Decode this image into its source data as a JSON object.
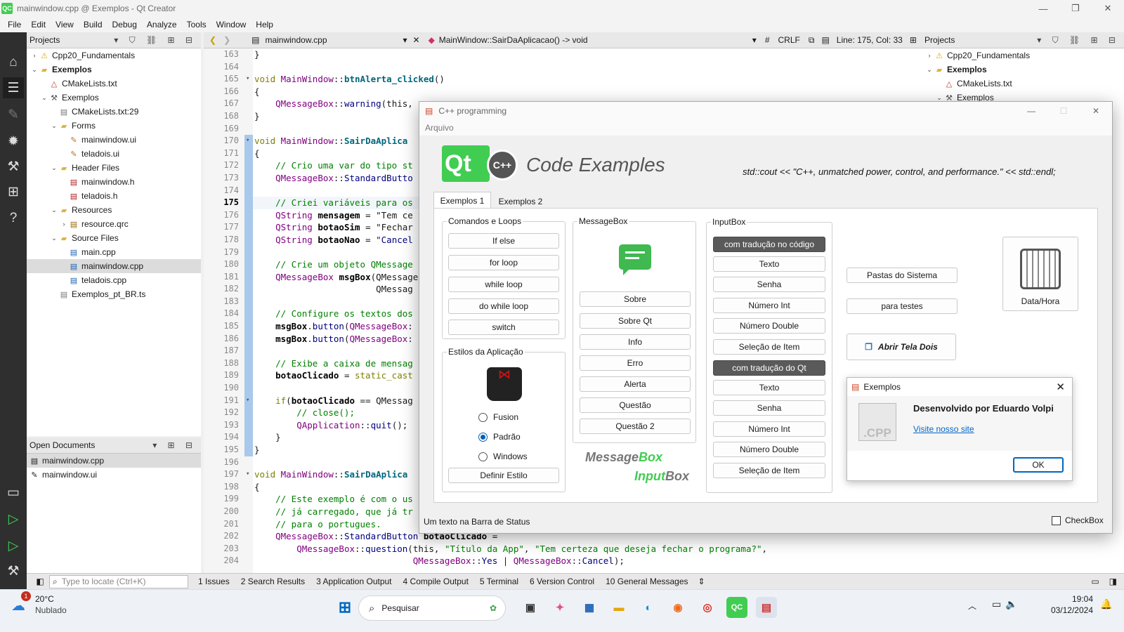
{
  "window": {
    "title": "mainwindow.cpp @ Exemplos - Qt Creator",
    "logo": "QC"
  },
  "menu": [
    "File",
    "Edit",
    "View",
    "Build",
    "Debug",
    "Analyze",
    "Tools",
    "Window",
    "Help"
  ],
  "left_panel": {
    "title": "Projects",
    "tree": [
      {
        "label": "Cpp20_Fundamentals",
        "indent": 0,
        "arrow": "›",
        "icon": "warning-icon",
        "bold": false
      },
      {
        "label": "Exemplos",
        "indent": 0,
        "arrow": "⌄",
        "icon": "folder-icon",
        "bold": true
      },
      {
        "label": "CMakeLists.txt",
        "indent": 1,
        "arrow": "",
        "icon": "cmake-file-icon",
        "bold": false
      },
      {
        "label": "Exemplos",
        "indent": 1,
        "arrow": "⌄",
        "icon": "hammer-icon",
        "bold": false
      },
      {
        "label": "CMakeLists.txt:29",
        "indent": 2,
        "arrow": "",
        "icon": "file-icon",
        "bold": false
      },
      {
        "label": "Forms",
        "indent": 2,
        "arrow": "⌄",
        "icon": "folder-icon",
        "bold": false
      },
      {
        "label": "mainwindow.ui",
        "indent": 3,
        "arrow": "",
        "icon": "ui-file-icon",
        "bold": false
      },
      {
        "label": "teladois.ui",
        "indent": 3,
        "arrow": "",
        "icon": "ui-file-icon",
        "bold": false
      },
      {
        "label": "Header Files",
        "indent": 2,
        "arrow": "⌄",
        "icon": "folder-icon",
        "bold": false
      },
      {
        "label": "mainwindow.h",
        "indent": 3,
        "arrow": "",
        "icon": "header-file-icon",
        "bold": false
      },
      {
        "label": "teladois.h",
        "indent": 3,
        "arrow": "",
        "icon": "header-file-icon",
        "bold": false
      },
      {
        "label": "Resources",
        "indent": 2,
        "arrow": "⌄",
        "icon": "folder-lock-icon",
        "bold": false
      },
      {
        "label": "resource.qrc",
        "indent": 3,
        "arrow": "›",
        "icon": "resource-file-icon",
        "bold": false
      },
      {
        "label": "Source Files",
        "indent": 2,
        "arrow": "⌄",
        "icon": "folder-icon",
        "bold": false
      },
      {
        "label": "main.cpp",
        "indent": 3,
        "arrow": "",
        "icon": "cpp-file-icon",
        "bold": false
      },
      {
        "label": "mainwindow.cpp",
        "indent": 3,
        "arrow": "",
        "icon": "cpp-file-icon",
        "bold": false,
        "selected": true
      },
      {
        "label": "teladois.cpp",
        "indent": 3,
        "arrow": "",
        "icon": "cpp-file-icon",
        "bold": false
      },
      {
        "label": "Exemplos_pt_BR.ts",
        "indent": 2,
        "arrow": "",
        "icon": "file-icon",
        "bold": false
      }
    ],
    "open_docs_title": "Open Documents",
    "open_docs": [
      "mainwindow.cpp",
      "mainwindow.ui"
    ]
  },
  "right_panel": {
    "title": "Projects",
    "tree": [
      {
        "label": "Cpp20_Fundamentals",
        "arrow": "›",
        "icon": "warning-icon",
        "bold": false,
        "indent": 0
      },
      {
        "label": "Exemplos",
        "arrow": "⌄",
        "icon": "folder-icon",
        "bold": true,
        "indent": 0
      },
      {
        "label": "CMakeLists.txt",
        "arrow": "",
        "icon": "cmake-file-icon",
        "bold": false,
        "indent": 1
      },
      {
        "label": "Exemplos",
        "arrow": "⌄",
        "icon": "hammer-icon",
        "bold": false,
        "indent": 1
      }
    ]
  },
  "editor_toolbar": {
    "file": "mainwindow.cpp",
    "symbol": "MainWindow::SairDaAplicacao() -> void",
    "hash": "#",
    "line_ending": "CRLF",
    "position": "Line: 175, Col: 33"
  },
  "code_lines": [
    {
      "n": "163",
      "c": "}"
    },
    {
      "n": "164",
      "c": ""
    },
    {
      "n": "165",
      "c": "void MainWindow::btnAlerta_clicked()"
    },
    {
      "n": "166",
      "c": "{"
    },
    {
      "n": "167",
      "c": "    QMessageBox::warning(this,"
    },
    {
      "n": "168",
      "c": "}"
    },
    {
      "n": "169",
      "c": ""
    },
    {
      "n": "170",
      "c": "void MainWindow::SairDaAplica"
    },
    {
      "n": "171",
      "c": "{"
    },
    {
      "n": "172",
      "c": "    // Crio uma var do tipo st"
    },
    {
      "n": "173",
      "c": "    QMessageBox::StandardButto"
    },
    {
      "n": "174",
      "c": ""
    },
    {
      "n": "175",
      "c": "    // Criei variáveis para os"
    },
    {
      "n": "176",
      "c": "    QString mensagem = \"Tem ce"
    },
    {
      "n": "177",
      "c": "    QString botaoSim = \"Fechar"
    },
    {
      "n": "178",
      "c": "    QString botaoNao = \"Cancel"
    },
    {
      "n": "179",
      "c": ""
    },
    {
      "n": "180",
      "c": "    // Crie um objeto QMessage"
    },
    {
      "n": "181",
      "c": "    QMessageBox msgBox(QMessage"
    },
    {
      "n": "182",
      "c": "                       QMessag"
    },
    {
      "n": "183",
      "c": ""
    },
    {
      "n": "184",
      "c": "    // Configure os textos dos"
    },
    {
      "n": "185",
      "c": "    msgBox.button(QMessageBox:"
    },
    {
      "n": "186",
      "c": "    msgBox.button(QMessageBox:"
    },
    {
      "n": "187",
      "c": ""
    },
    {
      "n": "188",
      "c": "    // Exibe a caixa de mensag"
    },
    {
      "n": "189",
      "c": "    botaoClicado = static_cast"
    },
    {
      "n": "190",
      "c": ""
    },
    {
      "n": "191",
      "c": "    if(botaoClicado == QMessag"
    },
    {
      "n": "192",
      "c": "        // close();"
    },
    {
      "n": "193",
      "c": "        QApplication::quit();"
    },
    {
      "n": "194",
      "c": "    }"
    },
    {
      "n": "195",
      "c": "}"
    },
    {
      "n": "196",
      "c": ""
    },
    {
      "n": "197",
      "c": "void MainWindow::SairDaAplica"
    },
    {
      "n": "198",
      "c": "{"
    },
    {
      "n": "199",
      "c": "    // Este exemplo é com o us"
    },
    {
      "n": "200",
      "c": "    // já carregado, que já tr"
    },
    {
      "n": "201",
      "c": "    // para o portugues."
    },
    {
      "n": "202",
      "c": "    QMessageBox::StandardButton botaoClicado ="
    },
    {
      "n": "203",
      "c": "        QMessageBox::question(this, \"Título da App\", \"Tem certeza que deseja fechar o programa?\","
    },
    {
      "n": "204",
      "c": "                              QMessageBox::Yes | QMessageBox::Cancel);"
    }
  ],
  "app": {
    "title": "C++ programming",
    "menu": "Arquivo",
    "logo_text": "Qt",
    "logo_sub": "C++",
    "heading": "Code Examples",
    "slogan": "std::cout << \"C++, unmatched power, control, and performance.\" << std::endl;",
    "tabs": [
      "Exemplos 1",
      "Exemplos 2"
    ],
    "group_loops": {
      "caption": "Comandos e Loops",
      "buttons": [
        "If else",
        "for loop",
        "while loop",
        "do while loop",
        "switch"
      ]
    },
    "group_styles": {
      "caption": "Estilos da Aplicação",
      "options": [
        "Fusion",
        "Padrão",
        "Windows"
      ],
      "selected": "Padrão",
      "button": "Definir Estilo"
    },
    "group_msgbox": {
      "caption": "MessageBox",
      "buttons": [
        "Sobre",
        "Sobre Qt",
        "Info",
        "Erro",
        "Alerta",
        "Questão",
        "Questão 2"
      ],
      "brand1a": "Message",
      "brand1b": "Box",
      "brand2a": "Input",
      "brand2b": "Box"
    },
    "group_input": {
      "caption": "InputBox",
      "header1": "com tradução no código",
      "buttons1": [
        "Texto",
        "Senha",
        "Número Int",
        "Número Double",
        "Seleção de Item"
      ],
      "header2": "com tradução do Qt",
      "buttons2": [
        "Texto",
        "Senha",
        "Número Int",
        "Número Double",
        "Seleção de Item"
      ]
    },
    "side_buttons": [
      "Pastas do Sistema",
      "para testes"
    ],
    "open_second": "Abrir Tela Dois",
    "datetime": "Data/Hora",
    "status": "Um texto na Barra de Status",
    "checkbox": "CheckBox"
  },
  "about": {
    "title": "Exemplos",
    "heading": "Desenvolvido por Eduardo Volpi",
    "link": "Visite nosso site",
    "ok": "OK",
    "icon_text": ".CPP"
  },
  "bottom_bar": {
    "search_placeholder": "Type to locate (Ctrl+K)",
    "tabs": [
      "1  Issues",
      "2  Search Results",
      "3  Application Output",
      "4  Compile Output",
      "5  Terminal",
      "6  Version Control",
      "10  General Messages"
    ]
  },
  "taskbar": {
    "temp": "20°C",
    "weather": "Nublado",
    "badge": "1",
    "search": "Pesquisar",
    "time": "19:04",
    "date": "03/12/2024"
  }
}
